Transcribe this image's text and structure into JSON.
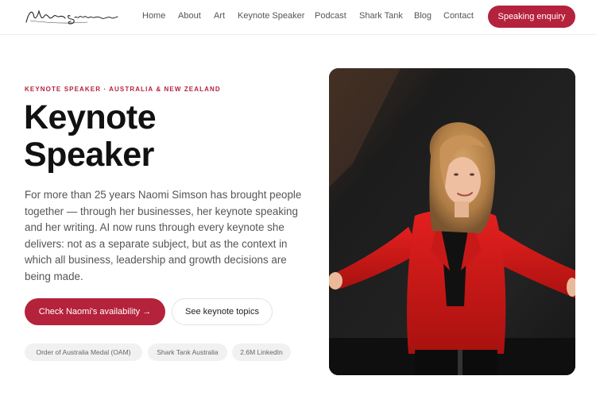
{
  "header": {
    "logo_alt": "Naomi Simson",
    "nav": [
      "Home",
      "About",
      "Art",
      "Keynote Speaker",
      "Podcast",
      "Shark Tank",
      "Blog",
      "Contact"
    ],
    "cta": "Speaking enquiry"
  },
  "hero": {
    "eyebrow": "KEYNOTE SPEAKER · AUSTRALIA & NEW ZEALAND",
    "title_line1": "Keynote",
    "title_line2": "Speaker",
    "body": "For more than 25 years Naomi Simson has brought people together — through her businesses, her keynote speaking and her writing. AI now runs through every keynote she delivers: not as a separate subject, but as the context in which all business, leadership and growth decisions are being made.",
    "primary_button": "Check Naomi's availability →",
    "secondary_button": "See keynote topics",
    "badges": [
      "Order of Australia Medal (OAM)",
      "Shark Tank Australia",
      "2.6M LinkedIn"
    ]
  },
  "colors": {
    "accent": "#b5223b",
    "text": "#111111",
    "muted": "#555555"
  }
}
